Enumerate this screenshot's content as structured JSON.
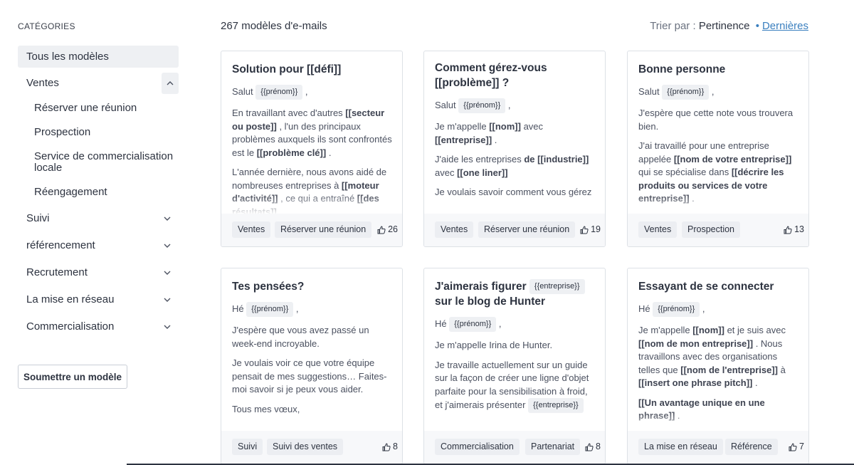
{
  "sidebar": {
    "title": "CATÉGORIES",
    "all_label": "Tous les modèles",
    "ventes": {
      "label": "Ventes",
      "sub": [
        "Réserver une réunion",
        "Prospection",
        "Service de commercialisation locale",
        "Réengagement"
      ]
    },
    "others": [
      "Suivi",
      "référencement",
      "Recrutement",
      "La mise en réseau",
      "Commercialisation"
    ],
    "submit_label": "Soumettre un modèle"
  },
  "header": {
    "count": "267 modèles d'e-mails",
    "sort_prefix": "Trier par :",
    "sort_selected": "Pertinence",
    "sort_separator": "•",
    "sort_alt": "Dernières"
  },
  "cards": [
    {
      "title": "Solution pour [[défi]]",
      "greeting": "Salut",
      "token": "{{prénom}}",
      "tags": [
        "Ventes",
        "Réserver une réunion"
      ],
      "likes": "26"
    },
    {
      "title": "Comment gérez-vous [[problème]] ?",
      "greeting": "Salut",
      "token": "{{prénom}}",
      "tags": [
        "Ventes",
        "Réserver une réunion"
      ],
      "likes": "19"
    },
    {
      "title": "Bonne personne",
      "greeting": "Salut",
      "token": "{{prénom}}",
      "p1": "J'espère que cette note vous trouvera bien.",
      "tags": [
        "Ventes",
        "Prospection"
      ],
      "likes": "13"
    },
    {
      "title": "Tes pensées?",
      "greeting": "Hé",
      "token": "{{prénom}}",
      "p1": "J'espère que vous avez passé un week-end incroyable.",
      "p2": "Je voulais voir ce que votre équipe pensait de mes suggestions… Faites-moi savoir si je peux vous aider.",
      "p3": "Tous mes vœux,",
      "tags": [
        "Suivi",
        "Suivi des ventes"
      ],
      "likes": "8"
    },
    {
      "title_a": "J'aimerais figurer",
      "title_token": "{{entreprise}}",
      "title_b": "sur le blog de Hunter",
      "greeting": "Hé",
      "token": "{{prénom}}",
      "p1": "Je m'appelle Irina de Hunter.",
      "p2": "Je travaille actuellement sur un guide sur la façon de créer une ligne d'objet parfaite pour la sensibilisation à froid, et j'aimerais présenter",
      "p2_token": "{{entreprise}}",
      "tags": [
        "Commercialisation",
        "Partenariat"
      ],
      "likes": "8"
    },
    {
      "title": "Essayant de se connecter",
      "greeting": "Hé",
      "token": "{{prénom}}",
      "tags": [
        "La mise en réseau",
        "Référence"
      ],
      "likes": "7"
    }
  ]
}
